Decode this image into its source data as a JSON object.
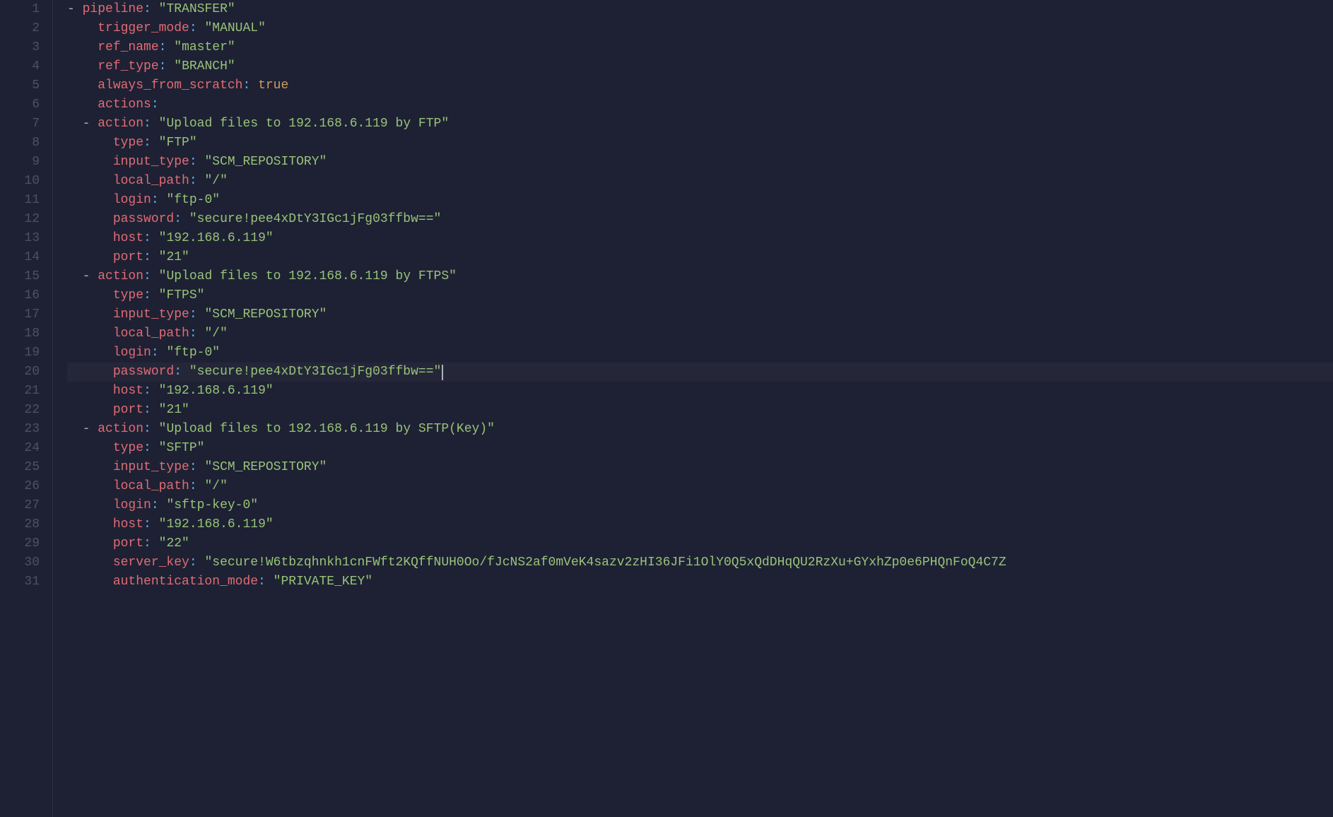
{
  "editor": {
    "activeLine": 20,
    "lines": [
      {
        "n": 1,
        "indent": 0,
        "dash": true,
        "key": "pipeline",
        "valueType": "str",
        "value": "\"TRANSFER\""
      },
      {
        "n": 2,
        "indent": 1,
        "dash": false,
        "key": "trigger_mode",
        "valueType": "str",
        "value": "\"MANUAL\""
      },
      {
        "n": 3,
        "indent": 1,
        "dash": false,
        "key": "ref_name",
        "valueType": "str",
        "value": "\"master\""
      },
      {
        "n": 4,
        "indent": 1,
        "dash": false,
        "key": "ref_type",
        "valueType": "str",
        "value": "\"BRANCH\""
      },
      {
        "n": 5,
        "indent": 1,
        "dash": false,
        "key": "always_from_scratch",
        "valueType": "bool",
        "value": "true"
      },
      {
        "n": 6,
        "indent": 1,
        "dash": false,
        "key": "actions",
        "valueType": "none",
        "value": ""
      },
      {
        "n": 7,
        "indent": 1,
        "dash": true,
        "key": "action",
        "valueType": "str",
        "value": "\"Upload files to 192.168.6.119 by FTP\""
      },
      {
        "n": 8,
        "indent": 2,
        "dash": false,
        "key": "type",
        "valueType": "str",
        "value": "\"FTP\""
      },
      {
        "n": 9,
        "indent": 2,
        "dash": false,
        "key": "input_type",
        "valueType": "str",
        "value": "\"SCM_REPOSITORY\""
      },
      {
        "n": 10,
        "indent": 2,
        "dash": false,
        "key": "local_path",
        "valueType": "str",
        "value": "\"/\""
      },
      {
        "n": 11,
        "indent": 2,
        "dash": false,
        "key": "login",
        "valueType": "str",
        "value": "\"ftp-0\""
      },
      {
        "n": 12,
        "indent": 2,
        "dash": false,
        "key": "password",
        "valueType": "str",
        "value": "\"secure!pee4xDtY3IGc1jFg03ffbw==\""
      },
      {
        "n": 13,
        "indent": 2,
        "dash": false,
        "key": "host",
        "valueType": "str",
        "value": "\"192.168.6.119\""
      },
      {
        "n": 14,
        "indent": 2,
        "dash": false,
        "key": "port",
        "valueType": "str",
        "value": "\"21\""
      },
      {
        "n": 15,
        "indent": 1,
        "dash": true,
        "key": "action",
        "valueType": "str",
        "value": "\"Upload files to 192.168.6.119 by FTPS\""
      },
      {
        "n": 16,
        "indent": 2,
        "dash": false,
        "key": "type",
        "valueType": "str",
        "value": "\"FTPS\""
      },
      {
        "n": 17,
        "indent": 2,
        "dash": false,
        "key": "input_type",
        "valueType": "str",
        "value": "\"SCM_REPOSITORY\""
      },
      {
        "n": 18,
        "indent": 2,
        "dash": false,
        "key": "local_path",
        "valueType": "str",
        "value": "\"/\""
      },
      {
        "n": 19,
        "indent": 2,
        "dash": false,
        "key": "login",
        "valueType": "str",
        "value": "\"ftp-0\""
      },
      {
        "n": 20,
        "indent": 2,
        "dash": false,
        "key": "password",
        "valueType": "str",
        "value": "\"secure!pee4xDtY3IGc1jFg03ffbw==\"",
        "cursorAfter": true
      },
      {
        "n": 21,
        "indent": 2,
        "dash": false,
        "key": "host",
        "valueType": "str",
        "value": "\"192.168.6.119\""
      },
      {
        "n": 22,
        "indent": 2,
        "dash": false,
        "key": "port",
        "valueType": "str",
        "value": "\"21\""
      },
      {
        "n": 23,
        "indent": 1,
        "dash": true,
        "key": "action",
        "valueType": "str",
        "value": "\"Upload files to 192.168.6.119 by SFTP(Key)\""
      },
      {
        "n": 24,
        "indent": 2,
        "dash": false,
        "key": "type",
        "valueType": "str",
        "value": "\"SFTP\""
      },
      {
        "n": 25,
        "indent": 2,
        "dash": false,
        "key": "input_type",
        "valueType": "str",
        "value": "\"SCM_REPOSITORY\""
      },
      {
        "n": 26,
        "indent": 2,
        "dash": false,
        "key": "local_path",
        "valueType": "str",
        "value": "\"/\""
      },
      {
        "n": 27,
        "indent": 2,
        "dash": false,
        "key": "login",
        "valueType": "str",
        "value": "\"sftp-key-0\""
      },
      {
        "n": 28,
        "indent": 2,
        "dash": false,
        "key": "host",
        "valueType": "str",
        "value": "\"192.168.6.119\""
      },
      {
        "n": 29,
        "indent": 2,
        "dash": false,
        "key": "port",
        "valueType": "str",
        "value": "\"22\""
      },
      {
        "n": 30,
        "indent": 2,
        "dash": false,
        "key": "server_key",
        "valueType": "str",
        "value": "\"secure!W6tbzqhnkh1cnFWft2KQffNUH0Oo/fJcNS2af0mVeK4sazv2zHI36JFi1OlY0Q5xQdDHqQU2RzXu+GYxhZp0e6PHQnFoQ4C7Z"
      },
      {
        "n": 31,
        "indent": 2,
        "dash": false,
        "key": "authentication_mode",
        "valueType": "str",
        "value": "\"PRIVATE_KEY\""
      }
    ]
  }
}
